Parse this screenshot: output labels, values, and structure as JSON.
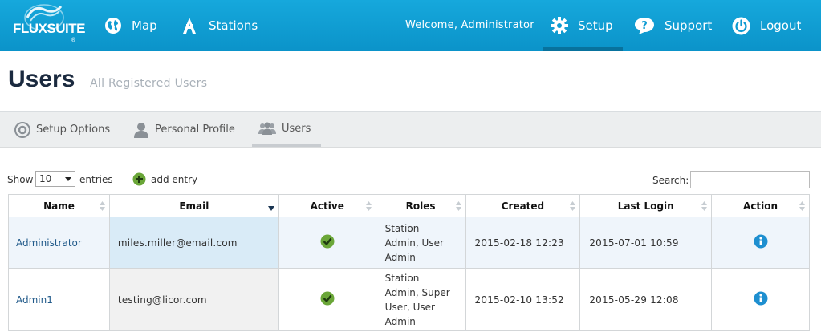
{
  "brand": {
    "name": "FLUXSUITE",
    "reg": "®"
  },
  "nav": {
    "map": "Map",
    "stations": "Stations",
    "welcome": "Welcome, Administrator",
    "setup": "Setup",
    "support": "Support",
    "logout": "Logout"
  },
  "header": {
    "title": "Users",
    "subtitle": "All Registered Users"
  },
  "subnav": {
    "setup_options": "Setup Options",
    "personal_profile": "Personal Profile",
    "users": "Users"
  },
  "controls": {
    "show": "Show",
    "entries_value": "10",
    "entries": "entries",
    "add_entry": "add entry",
    "search_label": "Search:"
  },
  "table": {
    "headers": [
      "Name",
      "Email",
      "Active",
      "Roles",
      "Created",
      "Last Login",
      "Action"
    ],
    "rows": [
      {
        "name": "Administrator",
        "email": "miles.miller@email.com",
        "roles": [
          "Station",
          "Admin, User",
          "Admin"
        ],
        "created": "2015-02-18 12:23",
        "last_login": "2015-07-01 10:59"
      },
      {
        "name": "Admin1",
        "email": "testing@licor.com",
        "roles": [
          "Station",
          "Admin, Super",
          "User, User",
          "Admin"
        ],
        "created": "2015-02-10 13:52",
        "last_login": "2015-05-29 12:08"
      }
    ]
  },
  "colors": {
    "nav_bg": "#0e9bd2",
    "title": "#1b2a3f",
    "link": "#215a8a",
    "check": "#6aa638",
    "info": "#1e8fd0"
  }
}
